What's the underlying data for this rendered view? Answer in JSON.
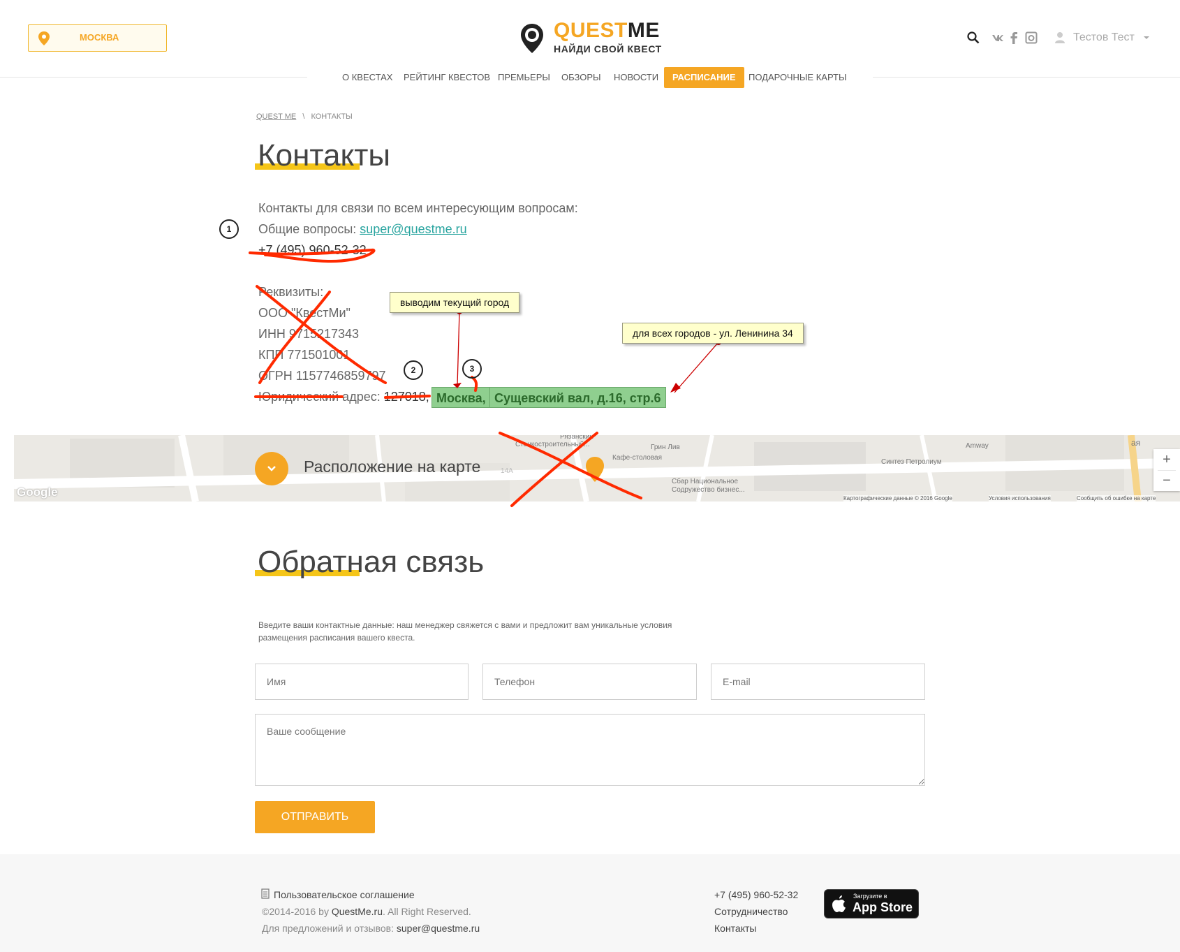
{
  "header": {
    "city": "МОСКВА",
    "logo_quest": "QUEST",
    "logo_me": "ME",
    "logo_tagline": "НАЙДИ СВОЙ КВЕСТ",
    "user_name": "Тестов Тест",
    "icons": [
      "search-icon",
      "vk-icon",
      "facebook-icon",
      "instagram-icon",
      "user-icon",
      "caret-down-icon"
    ]
  },
  "nav": {
    "items": [
      {
        "label": "О КВЕСТАХ",
        "active": false
      },
      {
        "label": "РЕЙТИНГ КВЕСТОВ",
        "active": false
      },
      {
        "label": "ПРЕМЬЕРЫ",
        "active": false
      },
      {
        "label": "ОБЗОРЫ",
        "active": false
      },
      {
        "label": "НОВОСТИ",
        "active": false
      },
      {
        "label": "РАСПИСАНИЕ",
        "active": true
      },
      {
        "label": "ПОДАРОЧНЫЕ КАРТЫ",
        "active": false
      }
    ]
  },
  "breadcrumb": {
    "home": "QUEST ME",
    "separator": "\\",
    "current": "КОНТАКТЫ"
  },
  "contacts": {
    "title": "Контакты",
    "intro": "Контакты для связи по всем интересующим вопросам:",
    "general_label": "Общие вопросы: ",
    "general_email": "super@questme.ru",
    "phone": "+7 (495) 960-52-32",
    "requisites_label": "Реквизиты:",
    "company": "ООО \"КвестМи\"",
    "inn": "ИНН 9715217343",
    "kpp": "КПП 771501001",
    "ogrn": "ОГРН 1157746859797",
    "address_label": "Юридический адрес: ",
    "zip": "127018, ",
    "city": "Москва,",
    "street": "Сущевский вал, д.16, стр.6"
  },
  "map": {
    "label": "Расположение на карте",
    "places": [
      "Рязанский",
      "Станкостроительный...",
      "Грин Лив",
      "Кафе-столовая",
      "Сбар Национальное",
      "Содружество бизнес...",
      "Синтез Петролиум",
      "Amway",
      "14А",
      "ая"
    ],
    "google": "Google",
    "attribution": "Картографические данные © 2016 Google",
    "terms": "Условия использования",
    "report": "Сообщить об ошибке на карте",
    "zoom_in": "+",
    "zoom_out": "−"
  },
  "feedback": {
    "title": "Обратная связь",
    "note": "Введите ваши контактные данные: наш менеджер свяжется с вами и предложит вам уникальные условия размещения расписания вашего квеста.",
    "name_placeholder": "Имя",
    "phone_placeholder": "Телефон",
    "email_placeholder": "E-mail",
    "message_placeholder": "Ваше сообщение",
    "submit_label": "ОТПРАВИТЬ"
  },
  "footer": {
    "agreement": "Пользовательское соглашение",
    "copyright_prefix": "©2014-2016 by ",
    "copyright_site": "QuestMe.ru",
    "copyright_suffix": ". All Right Reserved.",
    "feedback_label": "Для предложений и отзывов: ",
    "feedback_email": "super@questme.ru",
    "phone": "+7 (495) 960-52-32",
    "cooperation": "Сотрудничество",
    "contacts": "Контакты",
    "appstore_small": "Загрузите в",
    "appstore_big": "App Store"
  },
  "annotations": {
    "note_current_city": "выводим текущий город",
    "note_all_cities": "для всех городов - ул. Ленинина 34",
    "marker_1": "1",
    "marker_2": "2",
    "marker_3": "3"
  },
  "colors": {
    "accent": "#f5a623",
    "link": "#2aa5a0",
    "highlight": "#8fcf8f",
    "annotation_red": "#ff2a00"
  }
}
